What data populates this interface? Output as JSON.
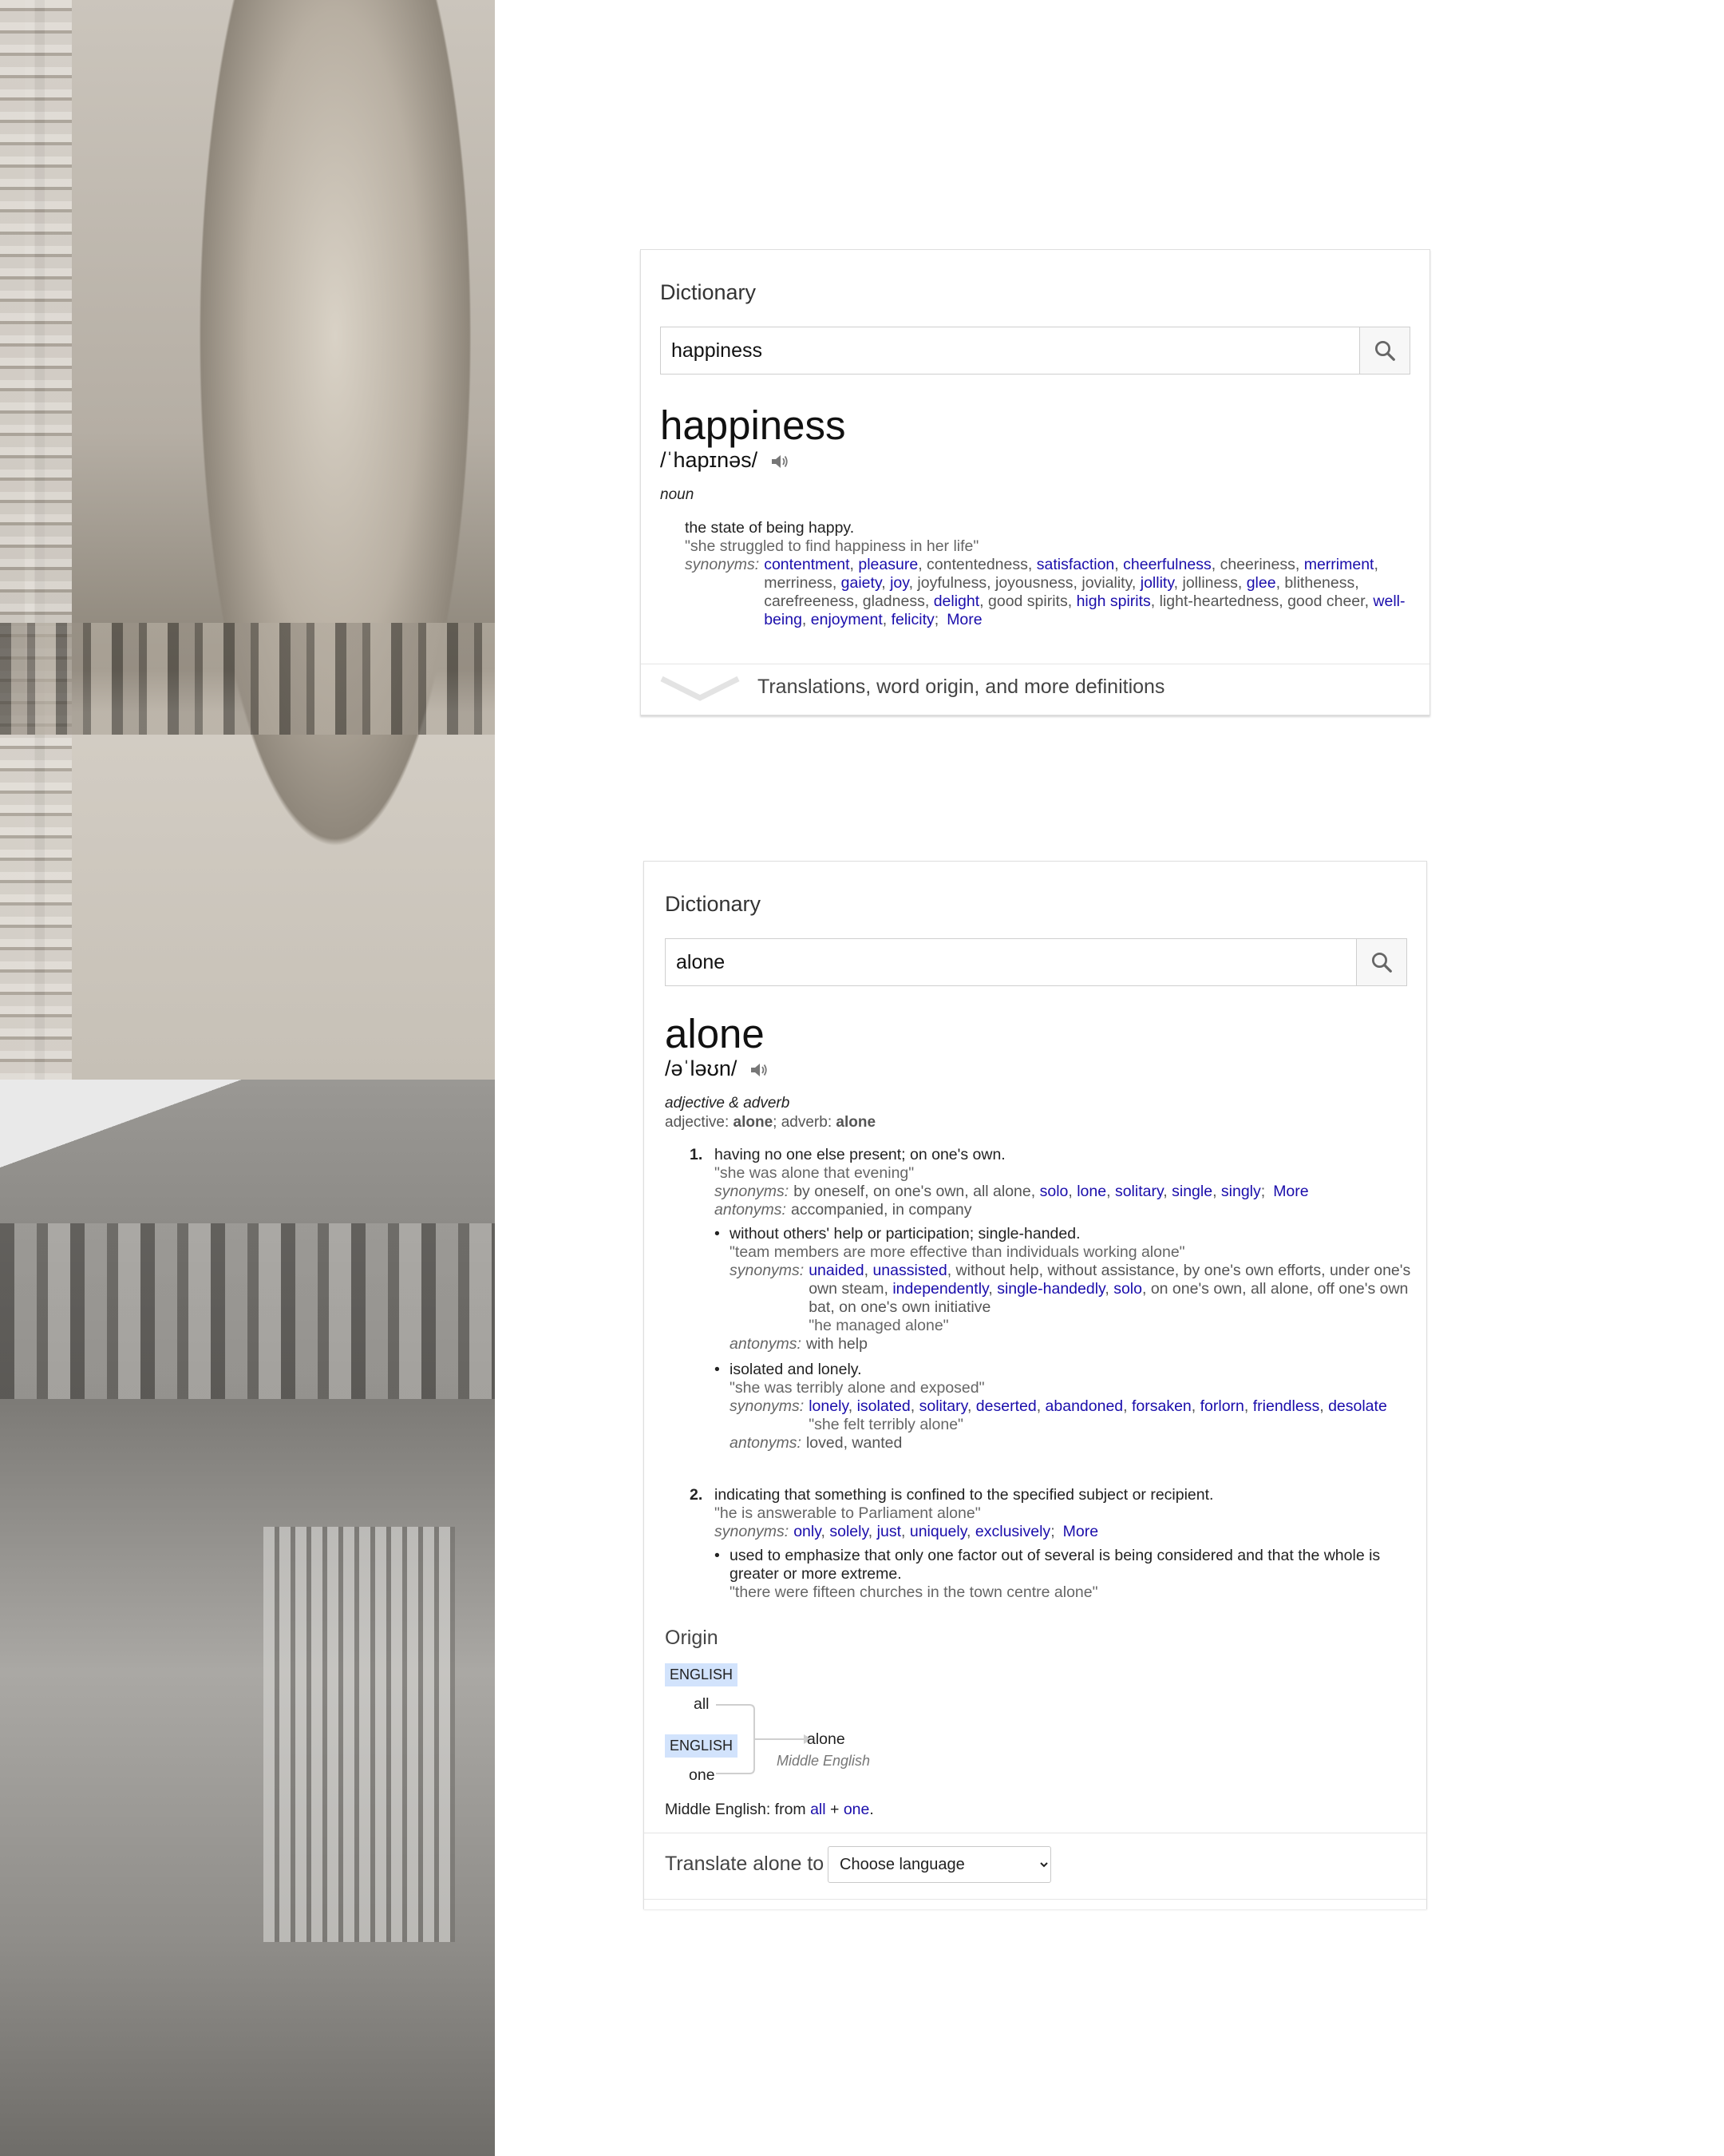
{
  "card1": {
    "title": "Dictionary",
    "search_value": "happiness",
    "headword": "happiness",
    "pronunciation": "/ˈhapɪnəs/",
    "pos": "noun",
    "sense": {
      "definition": "the state of being happy.",
      "example": "\"she struggled to find happiness in her life\"",
      "synonyms_label": "synonyms:",
      "synonyms": [
        {
          "t": "contentment",
          "l": true
        },
        {
          "t": "pleasure",
          "l": true
        },
        {
          "t": "contentedness",
          "l": false
        },
        {
          "t": "satisfaction",
          "l": true
        },
        {
          "t": "cheerfulness",
          "l": true
        },
        {
          "t": "cheeriness",
          "l": false
        },
        {
          "t": "merriment",
          "l": true
        },
        {
          "t": "merriness",
          "l": false
        },
        {
          "t": "gaiety",
          "l": true
        },
        {
          "t": "joy",
          "l": true
        },
        {
          "t": "joyfulness",
          "l": false
        },
        {
          "t": "joyousness",
          "l": false
        },
        {
          "t": "joviality",
          "l": false
        },
        {
          "t": "jollity",
          "l": true
        },
        {
          "t": "jolliness",
          "l": false
        },
        {
          "t": "glee",
          "l": true
        },
        {
          "t": "blitheness",
          "l": false
        },
        {
          "t": "carefreeness",
          "l": false
        },
        {
          "t": "gladness",
          "l": false
        },
        {
          "t": "delight",
          "l": true
        },
        {
          "t": "good spirits",
          "l": false
        },
        {
          "t": "high spirits",
          "l": true
        },
        {
          "t": "light-heartedness",
          "l": false
        },
        {
          "t": "good cheer",
          "l": false
        },
        {
          "t": "well-being",
          "l": true
        },
        {
          "t": "enjoyment",
          "l": true
        },
        {
          "t": "felicity",
          "l": true
        }
      ],
      "more": "More"
    },
    "footer": "Translations, word origin, and more definitions"
  },
  "card2": {
    "title": "Dictionary",
    "search_value": "alone",
    "headword": "alone",
    "pronunciation": "/əˈləʊn/",
    "pos": "adjective & adverb",
    "forms_adj_label": "adjective: ",
    "forms_adj": "alone",
    "forms_adv_label": "; adverb: ",
    "forms_adv": "alone",
    "senses": [
      {
        "num": "1.",
        "definition": "having no one else present; on one's own.",
        "example": "\"she was alone that evening\"",
        "synonyms_label": "synonyms:",
        "synonyms": [
          {
            "t": "by oneself",
            "l": false
          },
          {
            "t": "on one's own",
            "l": false
          },
          {
            "t": "all alone",
            "l": false
          },
          {
            "t": "solo",
            "l": true
          },
          {
            "t": "lone",
            "l": true
          },
          {
            "t": "solitary",
            "l": true
          },
          {
            "t": "single",
            "l": true
          },
          {
            "t": "singly",
            "l": true
          }
        ],
        "more": "More",
        "antonyms_label": "antonyms:",
        "antonyms": "accompanied, in company",
        "subs": [
          {
            "definition": "without others' help or participation; single-handed.",
            "example": "\"team members are more effective than individuals working alone\"",
            "synonyms_label": "synonyms:",
            "synonyms": [
              {
                "t": "unaided",
                "l": true
              },
              {
                "t": "unassisted",
                "l": true
              },
              {
                "t": "without help",
                "l": false
              },
              {
                "t": "without assistance",
                "l": false
              },
              {
                "t": "by one's own efforts",
                "l": false
              },
              {
                "t": "under one's own steam",
                "l": false
              },
              {
                "t": "independently",
                "l": true
              },
              {
                "t": "single-handedly",
                "l": true
              },
              {
                "t": "solo",
                "l": true
              },
              {
                "t": "on one's own",
                "l": false
              },
              {
                "t": "all alone",
                "l": false
              },
              {
                "t": "off one's own bat",
                "l": false
              },
              {
                "t": "on one's own initiative",
                "l": false
              }
            ],
            "syn_example": "\"he managed alone\"",
            "antonyms_label": "antonyms:",
            "antonyms": "with help"
          },
          {
            "definition": "isolated and lonely.",
            "example": "\"she was terribly alone and exposed\"",
            "synonyms_label": "synonyms:",
            "synonyms": [
              {
                "t": "lonely",
                "l": true
              },
              {
                "t": "isolated",
                "l": true
              },
              {
                "t": "solitary",
                "l": true
              },
              {
                "t": "deserted",
                "l": true
              },
              {
                "t": "abandoned",
                "l": true
              },
              {
                "t": "forsaken",
                "l": true
              },
              {
                "t": "forlorn",
                "l": true
              },
              {
                "t": "friendless",
                "l": true
              },
              {
                "t": "desolate",
                "l": true
              }
            ],
            "syn_example": "\"she felt terribly alone\"",
            "antonyms_label": "antonyms:",
            "antonyms": "loved, wanted"
          }
        ]
      },
      {
        "num": "2.",
        "definition": "indicating that something is confined to the specified subject or recipient.",
        "example": "\"he is answerable to Parliament alone\"",
        "synonyms_label": "synonyms:",
        "synonyms": [
          {
            "t": "only",
            "l": true
          },
          {
            "t": "solely",
            "l": true
          },
          {
            "t": "just",
            "l": true
          },
          {
            "t": "uniquely",
            "l": true
          },
          {
            "t": "exclusively",
            "l": true
          }
        ],
        "more": "More",
        "subs": [
          {
            "definition": "used to emphasize that only one factor out of several is being considered and that the whole is greater or more extreme.",
            "example": "\"there were fifteen churches in the town centre alone\""
          }
        ]
      }
    ],
    "origin": {
      "title": "Origin",
      "tag1": "ENGLISH",
      "word1": "all",
      "tag2": "ENGLISH",
      "word2": "one",
      "result": "alone",
      "result_lang": "Middle English",
      "note_prefix": "Middle English: from ",
      "note_link1": "all",
      "note_plus": " + ",
      "note_link2": "one",
      "note_suffix": "."
    },
    "translate_label": "Translate alone to",
    "translate_select": "Choose language"
  },
  "colors": {
    "link": "#1a0dab",
    "tag_bg": "#d2e3fc"
  },
  "icons": [
    "search-icon",
    "speaker-icon",
    "chevron-down-icon",
    "arrow-right-icon"
  ]
}
